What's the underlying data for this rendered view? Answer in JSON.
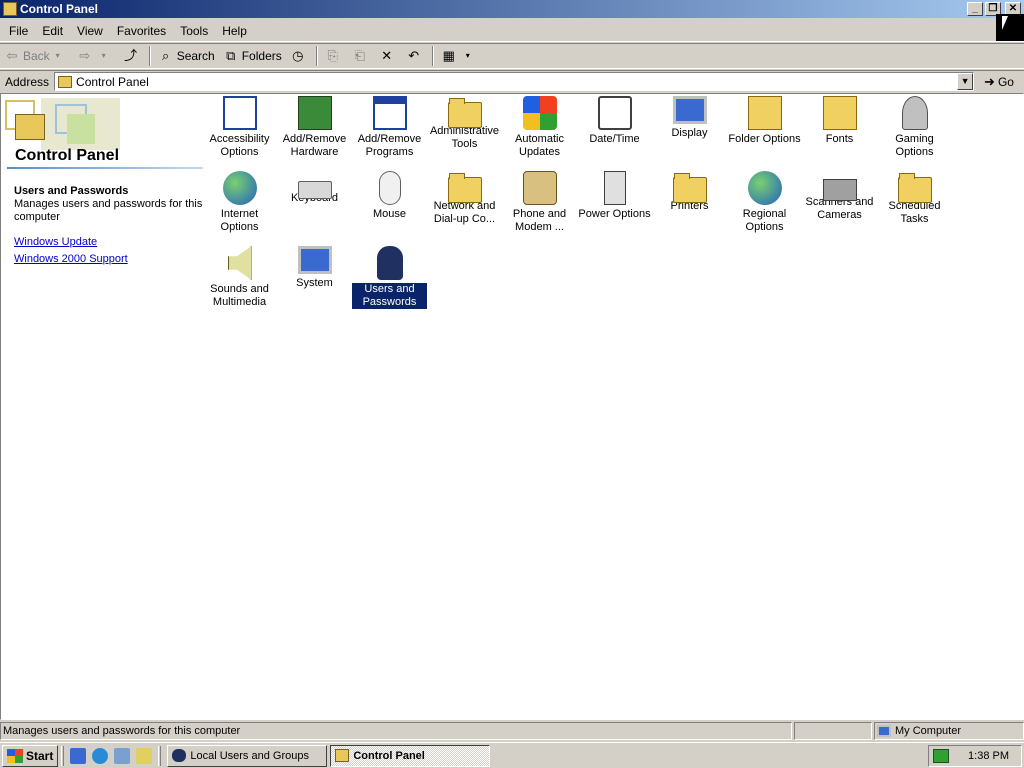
{
  "window": {
    "title": "Control Panel",
    "controls": {
      "minimize": "_",
      "restore": "❐",
      "close": "✕"
    }
  },
  "menu": [
    "File",
    "Edit",
    "View",
    "Favorites",
    "Tools",
    "Help"
  ],
  "toolbar": {
    "back": "Back",
    "search": "Search",
    "folders": "Folders"
  },
  "address": {
    "label": "Address",
    "value": "Control Panel",
    "go": "Go"
  },
  "left_pane": {
    "title": "Control Panel",
    "heading": "Users and Passwords",
    "description": "Manages users and passwords for this computer",
    "links": [
      "Windows Update",
      "Windows 2000 Support"
    ]
  },
  "items": [
    {
      "label": "Accessibility Options",
      "icon": "accessibility-icon"
    },
    {
      "label": "Add/Remove Hardware",
      "icon": "hardware-icon"
    },
    {
      "label": "Add/Remove Programs",
      "icon": "programs-icon"
    },
    {
      "label": "Administrative Tools",
      "icon": "admin-tools-icon"
    },
    {
      "label": "Automatic Updates",
      "icon": "windows-logo-icon"
    },
    {
      "label": "Date/Time",
      "icon": "clock-icon"
    },
    {
      "label": "Display",
      "icon": "display-icon"
    },
    {
      "label": "Folder Options",
      "icon": "folder-options-icon"
    },
    {
      "label": "Fonts",
      "icon": "fonts-icon"
    },
    {
      "label": "Gaming Options",
      "icon": "joystick-icon"
    },
    {
      "label": "Internet Options",
      "icon": "globe-icon"
    },
    {
      "label": "Keyboard",
      "icon": "keyboard-icon"
    },
    {
      "label": "Mouse",
      "icon": "mouse-icon"
    },
    {
      "label": "Network and Dial-up Co...",
      "icon": "network-icon"
    },
    {
      "label": "Phone and Modem ...",
      "icon": "phone-icon"
    },
    {
      "label": "Power Options",
      "icon": "power-icon"
    },
    {
      "label": "Printers",
      "icon": "printers-icon"
    },
    {
      "label": "Regional Options",
      "icon": "regional-globe-icon"
    },
    {
      "label": "Scanners and Cameras",
      "icon": "scanner-icon"
    },
    {
      "label": "Scheduled Tasks",
      "icon": "scheduled-tasks-icon"
    },
    {
      "label": "Sounds and Multimedia",
      "icon": "speaker-icon"
    },
    {
      "label": "System",
      "icon": "system-icon"
    },
    {
      "label": "Users and Passwords",
      "icon": "users-icon",
      "selected": true
    }
  ],
  "status_bar": {
    "text": "Manages users and passwords for this computer",
    "zone": "My Computer"
  },
  "taskbar": {
    "start": "Start",
    "tasks": [
      {
        "label": "Local Users and Groups",
        "active": false
      },
      {
        "label": "Control Panel",
        "active": true
      }
    ],
    "clock": "1:38 PM"
  }
}
